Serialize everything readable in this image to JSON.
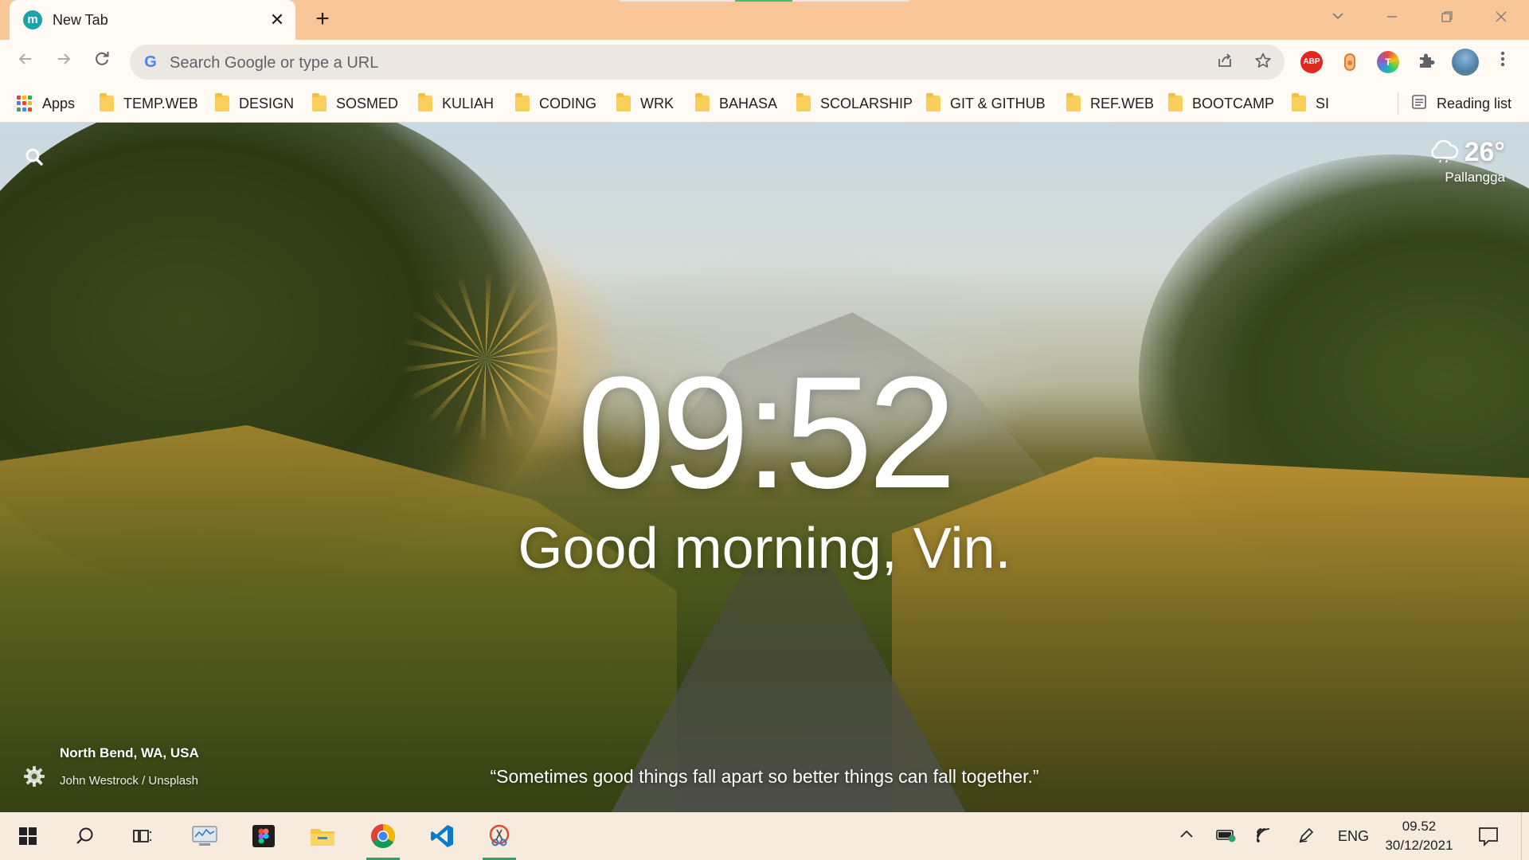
{
  "browser": {
    "tab": {
      "favicon_letter": "m",
      "title": "New Tab",
      "close_glyph": "✕"
    },
    "new_tab_glyph": "+",
    "omnibox": {
      "placeholder": "Search Google or type a URL",
      "g_letter": "G"
    },
    "extensions": [
      {
        "name": "adblock-plus",
        "label": "ABP",
        "color": "#e0281f"
      },
      {
        "name": "extension-orange",
        "label": "",
        "color": "#e87a25"
      },
      {
        "name": "extension-t",
        "label": "T",
        "color": "#6b5bd6"
      }
    ],
    "bookmarks_bar": {
      "apps_label": "Apps",
      "folders": [
        "TEMP.WEB",
        "DESIGN",
        "SOSMED",
        "KULIAH",
        "CODING",
        "WRK",
        "BAHASA",
        "SCOLARSHIP",
        "GIT & GITHUB",
        "REF.WEB",
        "BOOTCAMP",
        "SI"
      ],
      "reading_list_label": "Reading list"
    }
  },
  "momentum": {
    "weather": {
      "temperature": "26°",
      "location": "Pallangga"
    },
    "time": "09:52",
    "greeting": "Good morning, Vin.",
    "quote": "“Sometimes good things fall apart so better things can fall together.”",
    "photo": {
      "location": "North Bend, WA, USA",
      "credit": "John Westrock / Unsplash"
    }
  },
  "taskbar": {
    "language": "ENG",
    "time": "09.52",
    "date": "30/12/2021"
  },
  "colors": {
    "tabstrip": "#f8c697",
    "toolbar": "#fffaf4",
    "taskbar": "#f7ebde",
    "taskbar_active": "#2ba36b"
  }
}
